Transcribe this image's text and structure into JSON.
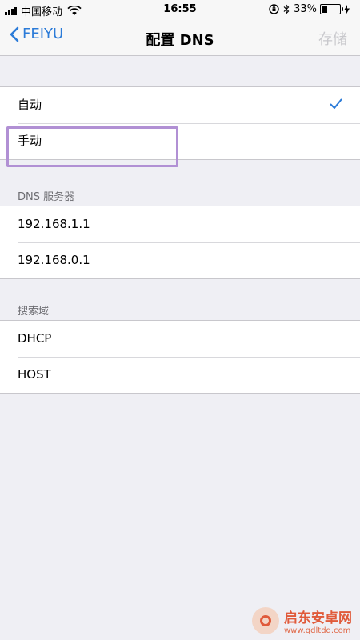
{
  "status_bar": {
    "carrier": "中国移动",
    "time": "16:55",
    "battery_percent": "33%",
    "battery_level": 0.33
  },
  "nav": {
    "back_label": "FEIYU",
    "title": "配置 DNS",
    "save_label": "存储"
  },
  "mode_options": [
    {
      "label": "自动",
      "selected": true
    },
    {
      "label": "手动",
      "selected": false
    }
  ],
  "dns_section": {
    "header": "DNS 服务器",
    "servers": [
      "192.168.1.1",
      "192.168.0.1"
    ]
  },
  "search_section": {
    "header": "搜索域",
    "domains": [
      "DHCP",
      "HOST"
    ]
  },
  "colors": {
    "accent": "#2b7bd8",
    "highlight": "#b190d4",
    "background": "#efeff4"
  },
  "icons": [
    "signal-icon",
    "wifi-icon",
    "lock-rotation-icon",
    "bluetooth-icon",
    "battery-icon",
    "charging-icon",
    "back-chevron-icon",
    "checkmark-icon"
  ],
  "watermark": {
    "name": "启东安卓网",
    "url": "www.qdltdq.com"
  }
}
